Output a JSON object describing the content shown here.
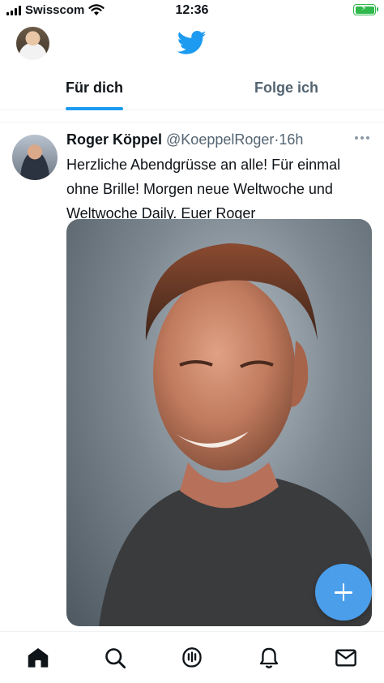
{
  "status_bar": {
    "carrier": "Swisscom",
    "time": "12:36",
    "battery_state": "charging",
    "icons": [
      "signal-icon",
      "wifi-icon",
      "battery-icon"
    ]
  },
  "header": {
    "logo": "twitter-bird-icon",
    "brand_color": "#1d9bf0"
  },
  "tabs": [
    {
      "label": "Für dich",
      "active": true
    },
    {
      "label": "Folge ich",
      "active": false
    }
  ],
  "tweet": {
    "author": "Roger Köppel",
    "handle": "@KoeppelRoger",
    "separator": "·",
    "time": "16h",
    "text": "Herzliche Abendgrüsse an alle! Für einmal ohne Brille! Morgen neue Weltwoche und Weltwoche Daily. Euer Roger"
  },
  "fab": {
    "icon": "plus-icon",
    "color": "#4a9eea"
  },
  "bottom_nav": [
    {
      "icon": "home-icon",
      "active": true
    },
    {
      "icon": "search-icon",
      "active": false
    },
    {
      "icon": "spaces-icon",
      "active": false
    },
    {
      "icon": "bell-icon",
      "active": false
    },
    {
      "icon": "mail-icon",
      "active": false
    }
  ]
}
